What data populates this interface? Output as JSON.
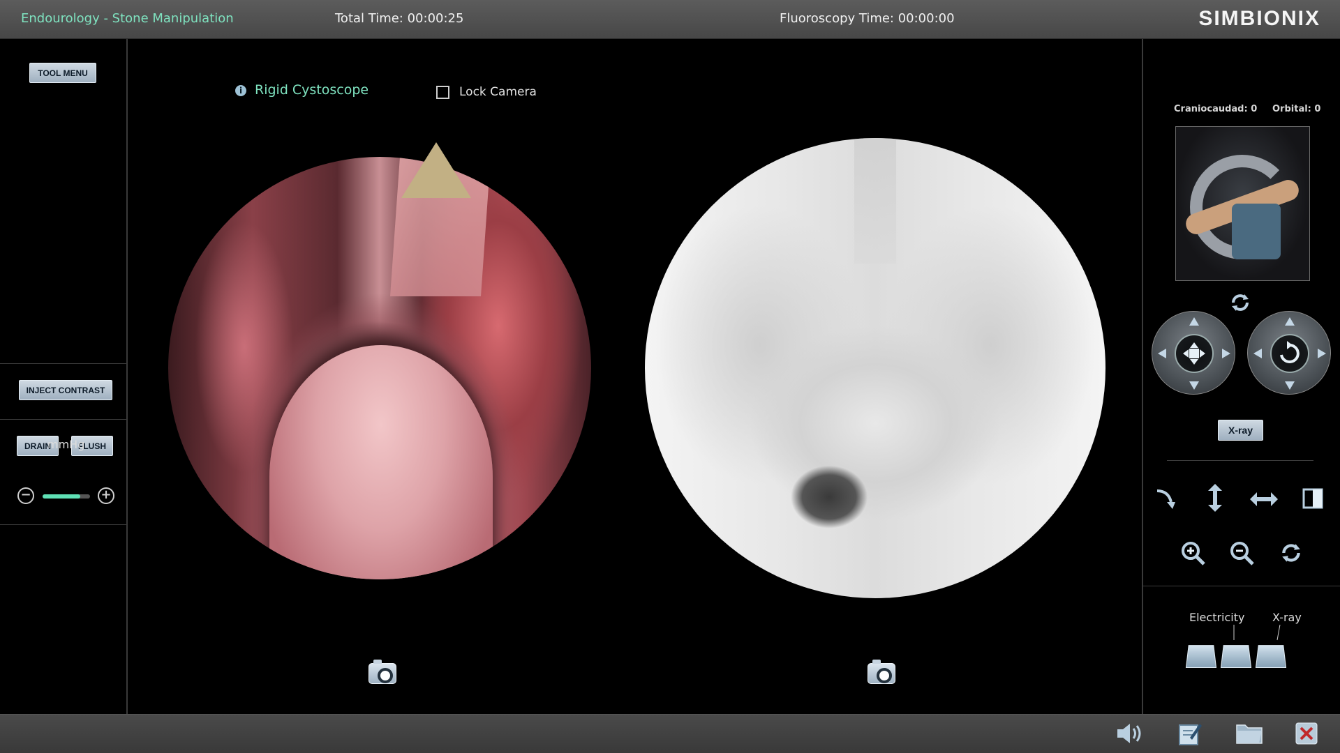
{
  "header": {
    "module_title": "Endourology - Stone Manipulation",
    "total_time": "Total Time: 00:00:25",
    "fluoroscopy_time": "Fluoroscopy Time: 00:00:00",
    "brand": "SIMBIONIX"
  },
  "left_panel": {
    "tool_menu_label": "TOOL MENU",
    "inject_contrast_label": "INJECT CONTRAST",
    "drain_label": "DRAIN",
    "flush_label": "FLUSH",
    "pressure_unit": "mmHg",
    "pressure_fraction": 0.8
  },
  "center": {
    "scope_name": "Rigid Cystoscope",
    "info_glyph": "i",
    "lock_camera_label": "Lock Camera",
    "lock_camera_checked": false
  },
  "right_panel": {
    "craniocaudad": "Craniocaudad: 0",
    "orbital": "Orbital: 0",
    "xray_button_label": "X-ray",
    "pedal_labels": {
      "electricity": "Electricity",
      "xray": "X-ray"
    }
  },
  "icons": {
    "info": "info-icon",
    "camera": "camera-icon",
    "refresh": "refresh-icon",
    "pan_joystick": "pan-joystick-icon",
    "rotate_joystick": "rotate-joystick-icon",
    "bend": "bend-arrow-icon",
    "vertical": "vertical-arrows-icon",
    "horizontal": "horizontal-arrows-icon",
    "invert": "invert-contrast-icon",
    "zoom_in": "zoom-in-icon",
    "zoom_out": "zoom-out-icon",
    "reset_view": "reset-view-icon",
    "sound": "sound-icon",
    "notes": "notes-icon",
    "folder": "folder-icon",
    "close": "close-icon"
  },
  "colors": {
    "accent_green": "#7fe3c0",
    "button_blue": "#9fb0c0",
    "close_red": "#c0282a"
  }
}
